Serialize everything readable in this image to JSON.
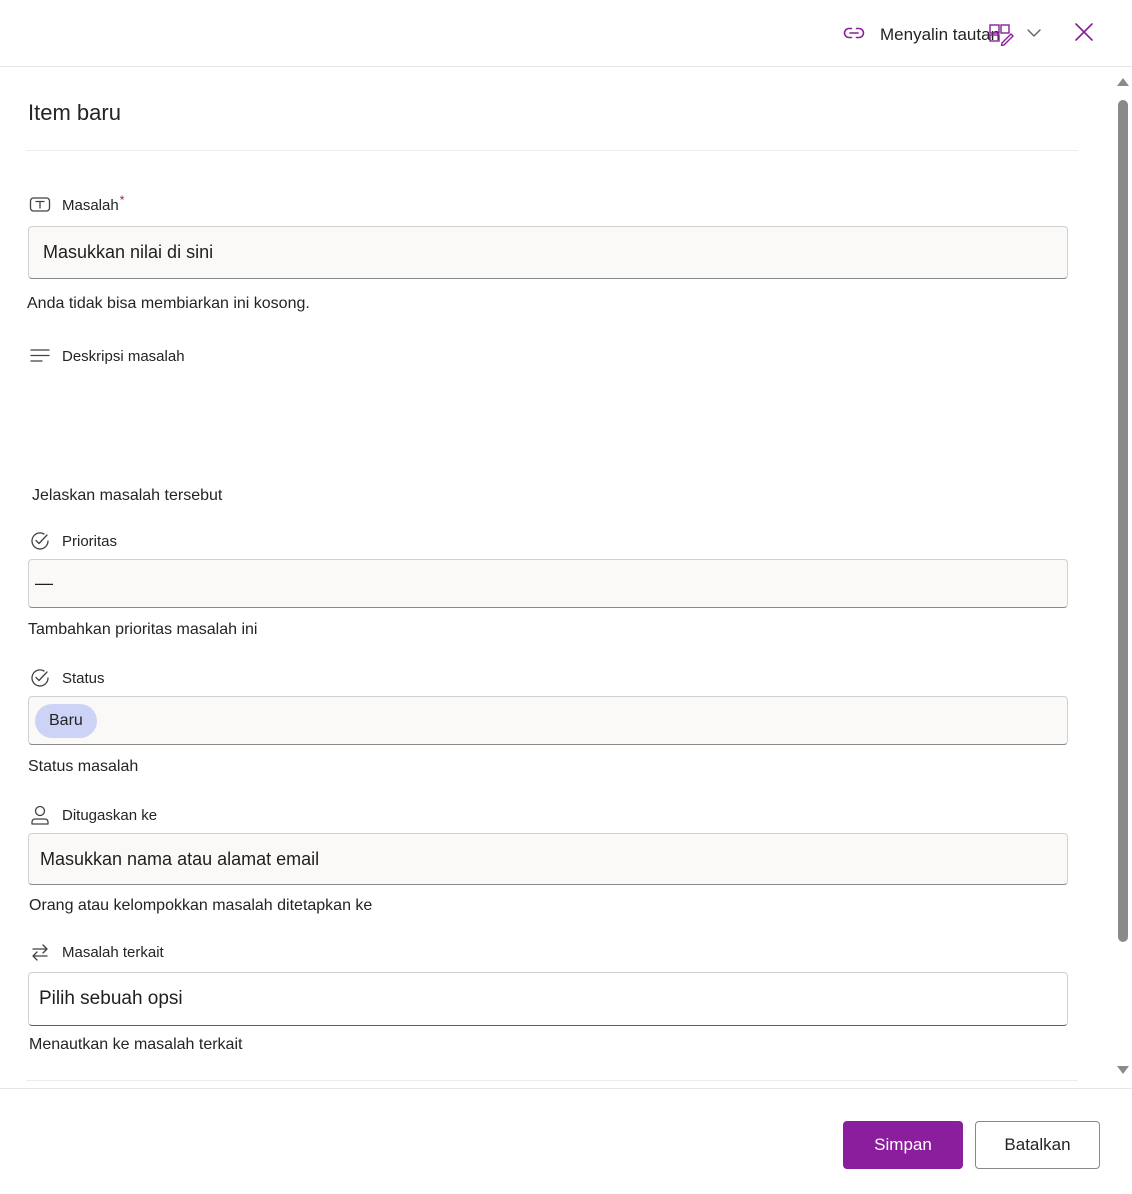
{
  "header": {
    "copy_link_label": "Menyalin tautan"
  },
  "form": {
    "title": "Item baru",
    "fields": {
      "issue": {
        "label": "Masalah",
        "required_mark": "*",
        "placeholder": "Masukkan nilai di sini",
        "helper": "Anda tidak bisa membiarkan ini kosong."
      },
      "description": {
        "label": "Deskripsi masalah",
        "helper": "Jelaskan masalah tersebut"
      },
      "priority": {
        "label": "Prioritas",
        "value": "—",
        "helper": "Tambahkan prioritas masalah ini"
      },
      "status": {
        "label": "Status",
        "value": "Baru",
        "helper": "Status masalah"
      },
      "assigned_to": {
        "label": "Ditugaskan ke",
        "placeholder": "Masukkan nama atau alamat email",
        "helper": "Orang atau kelompokkan masalah ditetapkan ke"
      },
      "related_issues": {
        "label": "Masalah terkait",
        "placeholder": "Pilih sebuah opsi",
        "helper": "Menautkan ke masalah terkait"
      }
    }
  },
  "footer": {
    "save_label": "Simpan",
    "cancel_label": "Batalkan"
  },
  "colors": {
    "accent": "#8a1e9c",
    "status_pill": "#cdd3f6",
    "input_bg": "#faf9f8"
  }
}
